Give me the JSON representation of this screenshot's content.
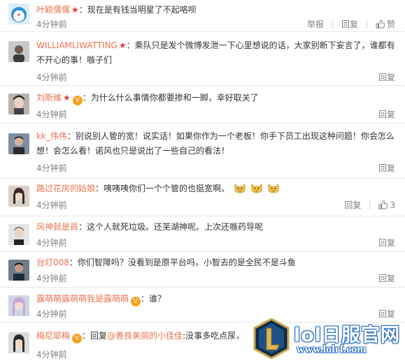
{
  "comments": [
    {
      "user": "叶颖儒儒",
      "text": "：现在是有钱当明星了不起咯呗",
      "time": "4分钟前",
      "report": "举报",
      "reply": "回复",
      "like": "赞"
    },
    {
      "user": "WILLIAMLIWATTING",
      "text": "：乘队只是发个微博发泄一下心里想说的话，大家别断下妄言了，谁都有不开心的事！嗾子们",
      "time": "4分钟前",
      "reply": "回复"
    },
    {
      "user": "刘斯维",
      "text": "：为什么什么事情你都要掺和一脚，幸好取关了",
      "time": "4分钟前",
      "reply": "回复"
    },
    {
      "user": "kk_伟伟",
      "text": "：别说别人管的宽！说实话！如果你作为一个老板！你手下员工出现这种问题！你会怎么想！会怎么看！诺风也只是说出了一些自己的看法！",
      "time": "4分钟前",
      "reply": "回复"
    },
    {
      "user": "路过花房的姑娘",
      "text": "：咦咦咦你们一个个管的也挺宽啊。",
      "time": "4分钟前",
      "reply": "回复",
      "like": "3"
    },
    {
      "user": "风神就是員",
      "text": "：这个人就死垃圾。还芜湖神呢。上次还嗾药导呢",
      "time": "4分钟前",
      "reply": "回复"
    },
    {
      "user": "台灯008",
      "text": "：你们智障吗？没看到是原平台吗，小智去的是全民不是斗鱼",
      "time": "4分钟前",
      "reply": "回复"
    },
    {
      "user": "露萌萌露萌萌我是露萌萌",
      "text": "：谁？",
      "time": "4分钟前",
      "reply": "回复"
    },
    {
      "user": "梅尼耶梅",
      "prefix": "：回复",
      "mention": "@善良美丽的小佳佳",
      "text": ":没事多吃点尿，",
      "time": "4分钟前"
    }
  ],
  "watermark": {
    "title": "lol日服官网",
    "url": "www.lolrf.com"
  },
  "colors": {
    "username": "#eb7350",
    "meta": "#808080",
    "text": "#333333"
  }
}
